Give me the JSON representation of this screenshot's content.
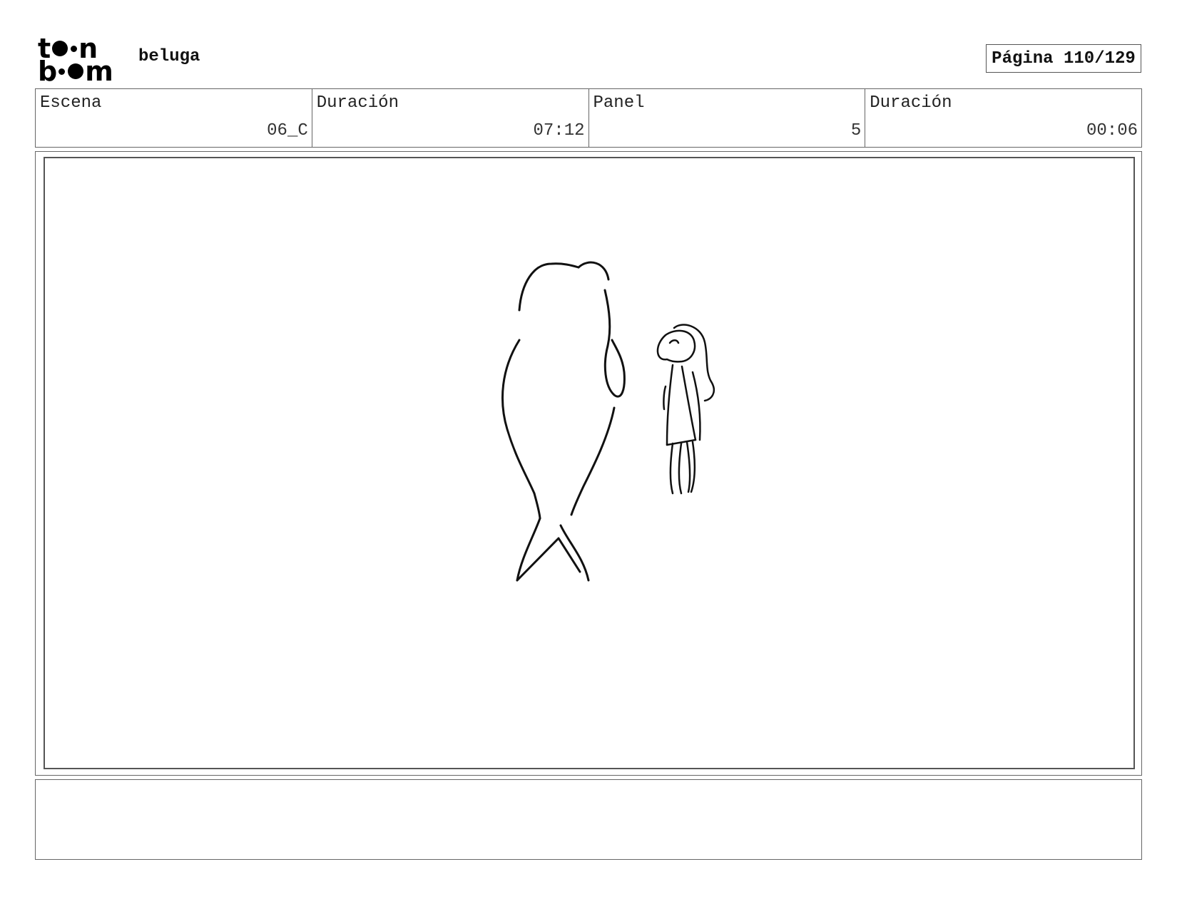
{
  "header": {
    "logo_letters": {
      "t": "t",
      "n": "n",
      "b": "b",
      "m": "m"
    },
    "logo_text": "toon boom",
    "project_title": "beluga",
    "page_label": "Página 110/129"
  },
  "info": {
    "scene_label": "Escena",
    "scene_value": "06_C",
    "scene_duration_label": "Duración",
    "scene_duration_value": "07:12",
    "panel_label": "Panel",
    "panel_value": "5",
    "panel_duration_label": "Duración",
    "panel_duration_value": "00:06"
  },
  "notes": {
    "text": ""
  }
}
